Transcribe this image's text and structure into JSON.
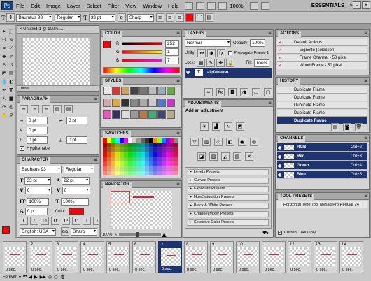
{
  "app_logo": "Ps",
  "menus": [
    "File",
    "Edit",
    "Image",
    "Layer",
    "Select",
    "Filter",
    "View",
    "Window",
    "Help"
  ],
  "zoom_top": "100%",
  "workspace": "ESSENTIALS",
  "options": {
    "font_family": "Bauhaus 93",
    "font_style": "Regular",
    "font_size": "33 pt",
    "aa": "Sharp"
  },
  "document": {
    "tab": "Untitled-1 @ 100% ...",
    "zoom": "100%"
  },
  "color_panel": {
    "title": "COLOR",
    "r_label": "R",
    "g_label": "G",
    "b_label": "B",
    "r": "252",
    "g": "1",
    "b": "7"
  },
  "styles_panel": {
    "title": "STYLES"
  },
  "swatches_panel": {
    "title": "SWATCHES"
  },
  "navigator": {
    "title": "NAVIGATOR",
    "zoom": "100%"
  },
  "paragraph": {
    "title": "PARAGRAPH",
    "v1": "0 pt",
    "v2": "0 pt",
    "v3": "0 pt",
    "v4": "0 pt",
    "v5": "0 pt",
    "hyphenate": "Hyphenate"
  },
  "character": {
    "title": "CHARACTER",
    "font": "Bauhaus 93",
    "style": "Regular",
    "size": "33 pt",
    "leading": "22 pt",
    "tracking": "0",
    "kern": "0",
    "vscale": "100%",
    "hscale": "100%",
    "baseline": "0 pt",
    "color_label": "Color:",
    "lang": "English: USA",
    "aa": "Sharp",
    "aa_label": "aa"
  },
  "layers": {
    "title": "LAYERS",
    "mode": "Normal",
    "opacity_label": "Opacity:",
    "opacity": "100%",
    "unify_label": "Unify:",
    "propagate": "Propagate Frame 1",
    "lock_label": "Lock:",
    "fill_label": "Fill:",
    "fill": "100%",
    "layer_name": "alpfabetoo",
    "layer_icon": "T"
  },
  "adjustments": {
    "title": "ADJUSTMENTS",
    "header": "Add an adjustment",
    "presets": [
      "Levels Presets",
      "Curves Presets",
      "Exposure Presets",
      "Hue/Saturation Presets",
      "Black & White Presets",
      "Channel Mixer Presets",
      "Selective Color Presets"
    ]
  },
  "actions": {
    "title": "ACTIONS",
    "items": [
      "Default Actions",
      "Vignette (selection)",
      "Frame Channel - 50 pixel",
      "Wood Frame - 50 pixel"
    ]
  },
  "history": {
    "title": "HISTORY",
    "items": [
      "Duplicate Frame",
      "Duplicate Frame",
      "Duplicate Frame",
      "Duplicate Frame",
      "Duplicate Frame"
    ]
  },
  "channels": {
    "title": "CHANNELS",
    "items": [
      {
        "name": "RGB",
        "shortcut": "Ctrl+2"
      },
      {
        "name": "Red",
        "shortcut": "Ctrl+3"
      },
      {
        "name": "Green",
        "shortcut": "Ctrl+4"
      },
      {
        "name": "Blue",
        "shortcut": "Ctrl+5"
      }
    ]
  },
  "tool_presets": {
    "title": "TOOL PRESETS",
    "item": "Horizontal Type Tool Myriad Pro Regular 24",
    "current_only": "Current Tool Only"
  },
  "animation": {
    "frames": [
      {
        "num": "1",
        "delay": "0 sec."
      },
      {
        "num": "2",
        "delay": "0 sec."
      },
      {
        "num": "3",
        "delay": "0 sec."
      },
      {
        "num": "4",
        "delay": "0 sec."
      },
      {
        "num": "5",
        "delay": "0 sec."
      },
      {
        "num": "6",
        "delay": "0 sec."
      },
      {
        "num": "7",
        "delay": "0 sec."
      },
      {
        "num": "8",
        "delay": "0 sec."
      },
      {
        "num": "9",
        "delay": "0 sec."
      },
      {
        "num": "10",
        "delay": "0 sec."
      },
      {
        "num": "11",
        "delay": "0 sec."
      },
      {
        "num": "12",
        "delay": "0 sec."
      },
      {
        "num": "13",
        "delay": "0 sec."
      },
      {
        "num": "14",
        "delay": "0 sec."
      }
    ],
    "selected_frame": 7,
    "loop": "Forever"
  },
  "colors": {
    "accent": "#1d3470",
    "fg_color": "#fc0107",
    "selection_blue": "#1d3470"
  }
}
